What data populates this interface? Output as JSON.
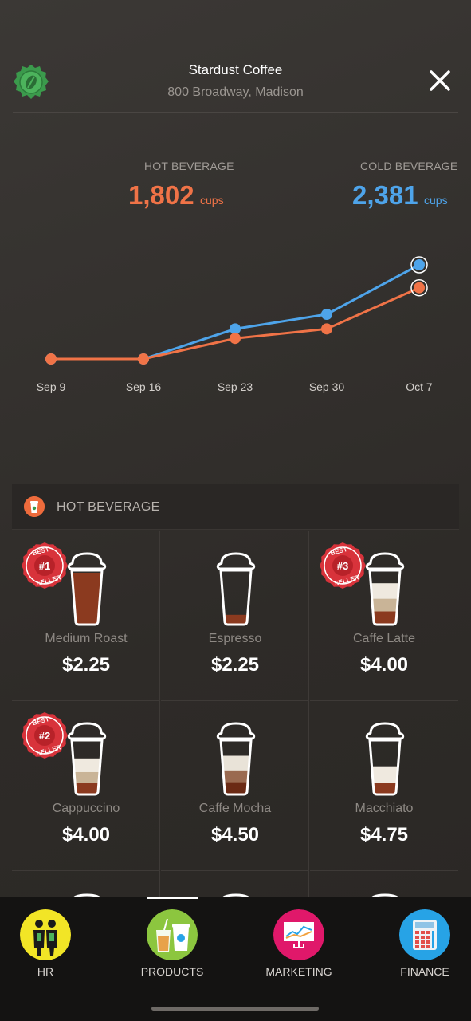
{
  "header": {
    "store_name": "Stardust Coffee",
    "store_address": "800 Broadway, Madison"
  },
  "stats": {
    "hot": {
      "label": "HOT BEVERAGE",
      "value": "1,802",
      "unit": "cups",
      "color": "#f07347"
    },
    "cold": {
      "label": "COLD BEVERAGE",
      "value": "2,381",
      "unit": "cups",
      "color": "#4ea4ea"
    }
  },
  "chart_data": {
    "type": "line",
    "categories": [
      "Sep 9",
      "Sep 16",
      "Sep 23",
      "Sep 30",
      "Oct 7"
    ],
    "series": [
      {
        "name": "HOT BEVERAGE",
        "color": "#f07347",
        "values": [
          0,
          0,
          520,
          760,
          1802
        ]
      },
      {
        "name": "COLD BEVERAGE",
        "color": "#4ea4ea",
        "values": [
          0,
          0,
          760,
          1130,
          2381
        ]
      }
    ]
  },
  "section": {
    "title": "HOT BEVERAGE",
    "icon": "coffee-cup-icon"
  },
  "products": [
    {
      "name": "Medium Roast",
      "price": "$2.25",
      "badge": "#1",
      "fill": 1.0,
      "layers": [
        "#8b3a1f"
      ]
    },
    {
      "name": "Espresso",
      "price": "$2.25",
      "badge": "",
      "fill": 0.2,
      "layers": [
        "#8b3a1f"
      ]
    },
    {
      "name": "Caffe Latte",
      "price": "$4.00",
      "badge": "#3",
      "fill": 0.8,
      "layers": [
        "#8b3a1f",
        "#c9b497",
        "#efe9df"
      ]
    },
    {
      "name": "Cappuccino",
      "price": "$4.00",
      "badge": "#2",
      "fill": 0.7,
      "layers": [
        "#8b3a1f",
        "#c9b497",
        "#efe9df"
      ]
    },
    {
      "name": "Caffe Mocha",
      "price": "$4.50",
      "badge": "",
      "fill": 0.75,
      "layers": [
        "#6b2a14",
        "#9a6a50",
        "#e9e3d8"
      ]
    },
    {
      "name": "Macchiato",
      "price": "$4.75",
      "badge": "",
      "fill": 0.55,
      "layers": [
        "#8b3a1f",
        "#efe9df"
      ]
    }
  ],
  "badge_text": "BEST SELLER",
  "tabs": [
    {
      "label": "HR",
      "icon": "staff-icon",
      "color": "#f2e526"
    },
    {
      "label": "PRODUCTS",
      "icon": "drinks-icon",
      "color": "#8cc63f"
    },
    {
      "label": "MARKETING",
      "icon": "presentation-chart-icon",
      "color": "#e0186a"
    },
    {
      "label": "FINANCE",
      "icon": "calculator-icon",
      "color": "#27a3e6"
    }
  ]
}
